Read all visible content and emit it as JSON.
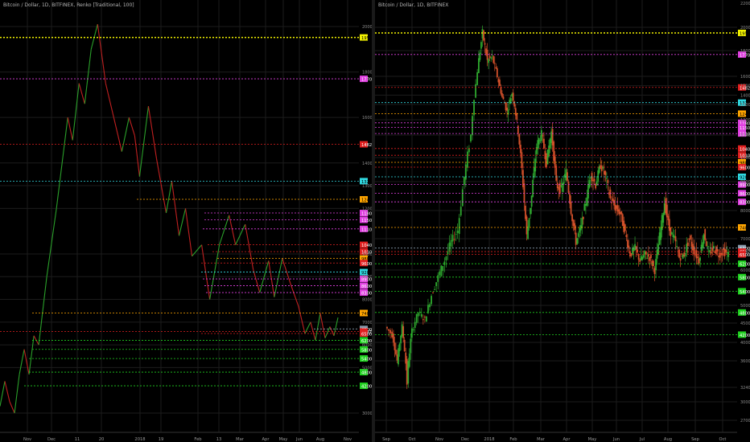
{
  "left_chart": {
    "title": "Bitcoin / Dollar, 1D, BITFINEX, Renko [Traditional, 100]"
  },
  "right_chart": {
    "title": "Bitcoin / Dollar, 1D, BITFINEX"
  },
  "chart_data": [
    {
      "type": "line",
      "title": "Bitcoin / Dollar, 1D, BITFINEX, Renko [Traditional, 100]",
      "ylim": [
        2600,
        20500
      ],
      "x_ticks": [
        "Nov",
        "Dec",
        "11",
        "20",
        "2018",
        "19",
        "Feb",
        "13",
        "Mar",
        "Apr",
        "May",
        "Jun",
        "Aug",
        "Nov"
      ],
      "y_ticks": [
        "20000.0",
        "18000.0",
        "16000.0",
        "14000.0",
        "13000.0",
        "12000.0",
        "10000.0",
        "9000.0",
        "8000.0",
        "7000.0",
        "6000.0",
        "5000.0",
        "3000.0"
      ],
      "price_path": [
        [
          0,
          3300
        ],
        [
          6,
          4400
        ],
        [
          12,
          3500
        ],
        [
          18,
          3000
        ],
        [
          24,
          4700
        ],
        [
          30,
          5800
        ],
        [
          36,
          4700
        ],
        [
          42,
          6400
        ],
        [
          48,
          6000
        ],
        [
          58,
          9000
        ],
        [
          70,
          12000
        ],
        [
          84,
          16000
        ],
        [
          90,
          15000
        ],
        [
          98,
          17500
        ],
        [
          105,
          16600
        ],
        [
          113,
          19000
        ],
        [
          121,
          20100
        ],
        [
          131,
          17500
        ],
        [
          141,
          16000
        ],
        [
          151,
          14500
        ],
        [
          160,
          16000
        ],
        [
          167,
          15200
        ],
        [
          173,
          13400
        ],
        [
          184,
          16500
        ],
        [
          194,
          14200
        ],
        [
          206,
          11800
        ],
        [
          213,
          13200
        ],
        [
          222,
          10800
        ],
        [
          230,
          12000
        ],
        [
          238,
          9900
        ],
        [
          250,
          10400
        ],
        [
          260,
          8000
        ],
        [
          272,
          10400
        ],
        [
          284,
          11700
        ],
        [
          292,
          10400
        ],
        [
          304,
          11300
        ],
        [
          314,
          9300
        ],
        [
          322,
          8300
        ],
        [
          333,
          9700
        ],
        [
          340,
          8100
        ],
        [
          350,
          9800
        ],
        [
          360,
          8700
        ],
        [
          370,
          7700
        ],
        [
          378,
          6500
        ],
        [
          385,
          7000
        ],
        [
          391,
          6200
        ],
        [
          397,
          7400
        ],
        [
          403,
          6300
        ],
        [
          409,
          6800
        ],
        [
          414,
          6400
        ],
        [
          419,
          7200
        ]
      ],
      "levels": [
        {
          "value": 19520.0,
          "label": "19520.0",
          "color": "#f3f300"
        },
        {
          "value": 17700.0,
          "label": "17700.0",
          "color": "#e040e0"
        },
        {
          "value": 14821.3,
          "label": "14821.3",
          "color": "#e02020"
        },
        {
          "value": 13200.0,
          "label": "13200.0",
          "color": "#30d8e0"
        },
        {
          "value": 12400.0,
          "label": "12400.0",
          "color": "#ffa500"
        },
        {
          "value": 11800.0,
          "label": "11800.0",
          "color": "#e040e0"
        },
        {
          "value": 11500.0,
          "label": "11500.0",
          "color": "#e040e0"
        },
        {
          "value": 11100.0,
          "label": "11100.0",
          "color": "#e040e0"
        },
        {
          "value": 10400.0,
          "label": "10400.0",
          "color": "#e02020"
        },
        {
          "value": 10100.0,
          "label": "10100.0",
          "color": "#e02020"
        },
        {
          "value": 9800.0,
          "label": "9800.0",
          "color": "#ffa500"
        },
        {
          "value": 9600.0,
          "label": "9600.0",
          "color": "#e02020"
        },
        {
          "value": 9200.0,
          "label": "9200.0",
          "color": "#30d8e0"
        },
        {
          "value": 8900.0,
          "label": "8900.0",
          "color": "#e040e0"
        },
        {
          "value": 8600.0,
          "label": "8600.0",
          "color": "#e040e0"
        },
        {
          "value": 8300.0,
          "label": "8300.0",
          "color": "#e040e0"
        },
        {
          "value": 7400.0,
          "label": "7400.0",
          "color": "#ffa500"
        },
        {
          "value": 6700.0,
          "label": "6700.0",
          "color": "#8899aa"
        },
        {
          "value": 6587.7,
          "label": "6587.7",
          "color": "#e02020"
        },
        {
          "value": 6500.0,
          "label": "6500.0",
          "color": "#e02020"
        },
        {
          "value": 6200.0,
          "label": "6200.0",
          "color": "#20d020"
        },
        {
          "value": 5800.0,
          "label": "5800.0",
          "color": "#20d020"
        },
        {
          "value": 5400.0,
          "label": "5400.0",
          "color": "#20d020"
        },
        {
          "value": 4800.0,
          "label": "4800.0",
          "color": "#20d020"
        },
        {
          "value": 4200.0,
          "label": "4200.0",
          "color": "#20d020"
        }
      ]
    },
    {
      "type": "line",
      "title": "Bitcoin / Dollar, 1D, BITFINEX",
      "ylim": [
        2600,
        23000
      ],
      "x_ticks": [
        "Sep",
        "Oct",
        "Nov",
        "Dec",
        "2018",
        "Feb",
        "Mar",
        "Apr",
        "May",
        "Jun",
        "Jul",
        "Aug",
        "Sep",
        "Oct"
      ],
      "y_ticks": [
        "22000.0",
        "20000.0",
        "18000.0",
        "16000.0",
        "15000.0",
        "14000.0",
        "13000.0",
        "12000.0",
        "11000.0",
        "10000.0",
        "9000.0",
        "8000.0",
        "7000.0",
        "6000.0",
        "5000.0",
        "4500.0",
        "4000.0",
        "3600.0",
        "3240.0",
        "3000.0",
        "2700.0"
      ],
      "price_path": [
        [
          0,
          4400
        ],
        [
          8,
          4200
        ],
        [
          14,
          3600
        ],
        [
          20,
          4400
        ],
        [
          26,
          3300
        ],
        [
          32,
          4300
        ],
        [
          40,
          4800
        ],
        [
          48,
          4600
        ],
        [
          56,
          5300
        ],
        [
          64,
          5800
        ],
        [
          72,
          6300
        ],
        [
          80,
          6900
        ],
        [
          88,
          7300
        ],
        [
          96,
          9200
        ],
        [
          104,
          11000
        ],
        [
          112,
          16500
        ],
        [
          118,
          19500
        ],
        [
          124,
          17200
        ],
        [
          130,
          17500
        ],
        [
          136,
          16000
        ],
        [
          142,
          13800
        ],
        [
          148,
          12500
        ],
        [
          154,
          14200
        ],
        [
          160,
          11800
        ],
        [
          166,
          9500
        ],
        [
          172,
          7100
        ],
        [
          178,
          8500
        ],
        [
          184,
          10500
        ],
        [
          190,
          11100
        ],
        [
          196,
          9800
        ],
        [
          202,
          11200
        ],
        [
          208,
          8900
        ],
        [
          214,
          8700
        ],
        [
          220,
          9400
        ],
        [
          226,
          8000
        ],
        [
          232,
          6900
        ],
        [
          238,
          7400
        ],
        [
          244,
          8300
        ],
        [
          250,
          9300
        ],
        [
          256,
          8900
        ],
        [
          262,
          9700
        ],
        [
          268,
          9200
        ],
        [
          274,
          8400
        ],
        [
          280,
          8100
        ],
        [
          286,
          7900
        ],
        [
          292,
          7200
        ],
        [
          298,
          6500
        ],
        [
          304,
          6700
        ],
        [
          310,
          6300
        ],
        [
          316,
          6500
        ],
        [
          322,
          6400
        ],
        [
          328,
          6000
        ],
        [
          334,
          7100
        ],
        [
          340,
          8300
        ],
        [
          346,
          7300
        ],
        [
          352,
          7000
        ],
        [
          358,
          6400
        ],
        [
          364,
          6500
        ],
        [
          370,
          7000
        ],
        [
          376,
          6600
        ],
        [
          382,
          6300
        ],
        [
          388,
          7200
        ],
        [
          394,
          6500
        ],
        [
          400,
          6700
        ],
        [
          406,
          6500
        ],
        [
          412,
          6600
        ],
        [
          418,
          6500
        ]
      ],
      "levels": [
        {
          "value": 19520.0,
          "label": "19520.0",
          "color": "#f3f300"
        },
        {
          "value": 17700.0,
          "label": "17700.0",
          "color": "#e040e0"
        },
        {
          "value": 14821.3,
          "label": "14821.3",
          "color": "#e02020"
        },
        {
          "value": 13200.0,
          "label": "13200.0",
          "color": "#30d8e0"
        },
        {
          "value": 12400.0,
          "label": "12400.0",
          "color": "#ffa500"
        },
        {
          "value": 11800.0,
          "label": "11800.0",
          "color": "#e040e0"
        },
        {
          "value": 11500.0,
          "label": "11500.0",
          "color": "#e040e0"
        },
        {
          "value": 11100.0,
          "label": "11100.0",
          "color": "#e040e0"
        },
        {
          "value": 10400.0,
          "label": "10400.0",
          "color": "#e02020"
        },
        {
          "value": 10100.0,
          "label": "10100.0",
          "color": "#e02020"
        },
        {
          "value": 9800.0,
          "label": "9800.0",
          "color": "#ffa500"
        },
        {
          "value": 9600.0,
          "label": "9600.0",
          "color": "#e02020"
        },
        {
          "value": 9200.0,
          "label": "9200.0",
          "color": "#30d8e0"
        },
        {
          "value": 8900.0,
          "label": "8900.0",
          "color": "#e040e0"
        },
        {
          "value": 8600.0,
          "label": "8600.0",
          "color": "#e040e0"
        },
        {
          "value": 8300.0,
          "label": "8300.0",
          "color": "#e040e0"
        },
        {
          "value": 7400.0,
          "label": "7400.0",
          "color": "#ffa500"
        },
        {
          "value": 6700.0,
          "label": "6700.0",
          "color": "#8899aa"
        },
        {
          "value": 6587.7,
          "label": "6587.7",
          "color": "#e02020"
        },
        {
          "value": 6500.0,
          "label": "6500.0",
          "color": "#e02020"
        },
        {
          "value": 6200.0,
          "label": "6200.0",
          "color": "#20d020"
        },
        {
          "value": 5800.0,
          "label": "5800.0",
          "color": "#20d020"
        },
        {
          "value": 5400.0,
          "label": "5400.0",
          "color": "#20d020"
        },
        {
          "value": 4800.0,
          "label": "4800.0",
          "color": "#20d020"
        },
        {
          "value": 4200.0,
          "label": "4200.0",
          "color": "#20d020"
        }
      ]
    }
  ]
}
